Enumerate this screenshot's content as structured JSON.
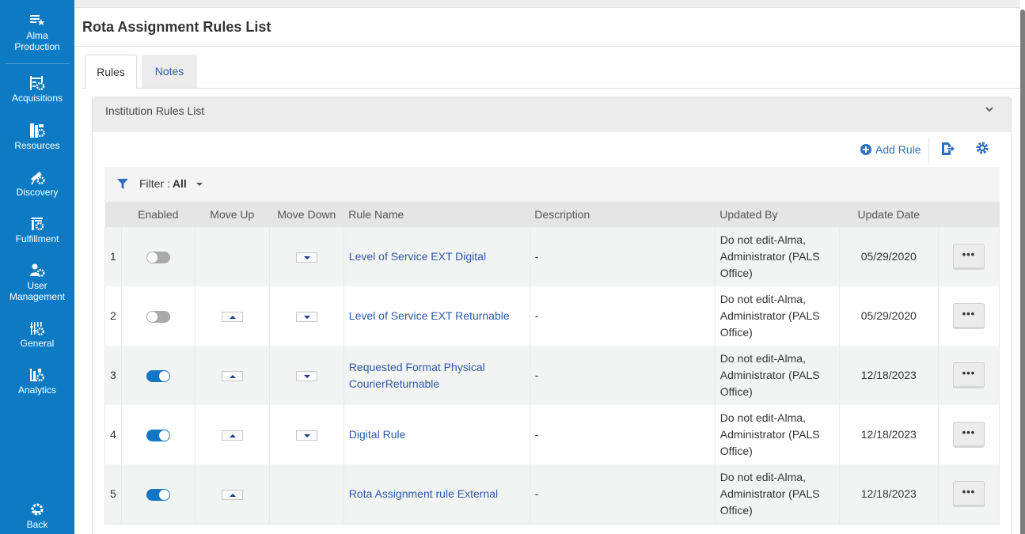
{
  "sidebar": {
    "items": [
      {
        "label": "Alma Production",
        "icon": "list-star-icon"
      },
      {
        "label": "Acquisitions",
        "icon": "acquisitions-icon"
      },
      {
        "label": "Resources",
        "icon": "resources-icon"
      },
      {
        "label": "Discovery",
        "icon": "telescope-icon"
      },
      {
        "label": "Fulfillment",
        "icon": "fulfillment-icon"
      },
      {
        "label": "User Management",
        "icon": "user-gear-icon"
      },
      {
        "label": "General",
        "icon": "sliders-icon"
      },
      {
        "label": "Analytics",
        "icon": "analytics-icon"
      },
      {
        "label": "Back",
        "icon": "back-gear-icon"
      }
    ],
    "label_lines": {
      "alma": [
        "Alma",
        "Production"
      ],
      "user": [
        "User",
        "Management"
      ]
    }
  },
  "page": {
    "title": "Rota Assignment Rules List"
  },
  "tabs": [
    {
      "label": "Rules",
      "active": true
    },
    {
      "label": "Notes",
      "active": false
    }
  ],
  "panel": {
    "title": "Institution Rules List",
    "add_label": "Add Rule",
    "filter_label": "Filter :",
    "filter_value": "All"
  },
  "colors": {
    "sidebar": "#0d7bc3",
    "link": "#2f5aa8",
    "toggle_on": "#1177c4",
    "toggle_off": "#a9a9a9"
  },
  "table": {
    "columns": [
      "",
      "Enabled",
      "Move Up",
      "Move Down",
      "Rule Name",
      "Description",
      "Updated By",
      "Update Date",
      ""
    ],
    "rows": [
      {
        "num": "1",
        "enabled": false,
        "move_up": false,
        "move_down": true,
        "name": "Level of Service EXT Digital",
        "description": "-",
        "updated_by": "Do not edit-Alma, Administrator (PALS Office)",
        "date": "05/29/2020",
        "more": "•••"
      },
      {
        "num": "2",
        "enabled": false,
        "move_up": true,
        "move_down": true,
        "name": "Level of Service EXT Returnable",
        "description": "-",
        "updated_by": "Do not edit-Alma, Administrator (PALS Office)",
        "date": "05/29/2020",
        "more": "•••"
      },
      {
        "num": "3",
        "enabled": true,
        "move_up": true,
        "move_down": true,
        "name": "Requested Format Physical CourierReturnable",
        "description": "-",
        "updated_by": "Do not edit-Alma, Administrator (PALS Office)",
        "date": "12/18/2023",
        "more": "•••"
      },
      {
        "num": "4",
        "enabled": true,
        "move_up": true,
        "move_down": true,
        "name": "Digital Rule",
        "description": "-",
        "updated_by": "Do not edit-Alma, Administrator (PALS Office)",
        "date": "12/18/2023",
        "more": "•••"
      },
      {
        "num": "5",
        "enabled": true,
        "move_up": true,
        "move_down": false,
        "name": "Rota Assignment rule External",
        "description": "-",
        "updated_by": "Do not edit-Alma, Administrator (PALS Office)",
        "date": "12/18/2023",
        "more": "•••"
      }
    ]
  }
}
